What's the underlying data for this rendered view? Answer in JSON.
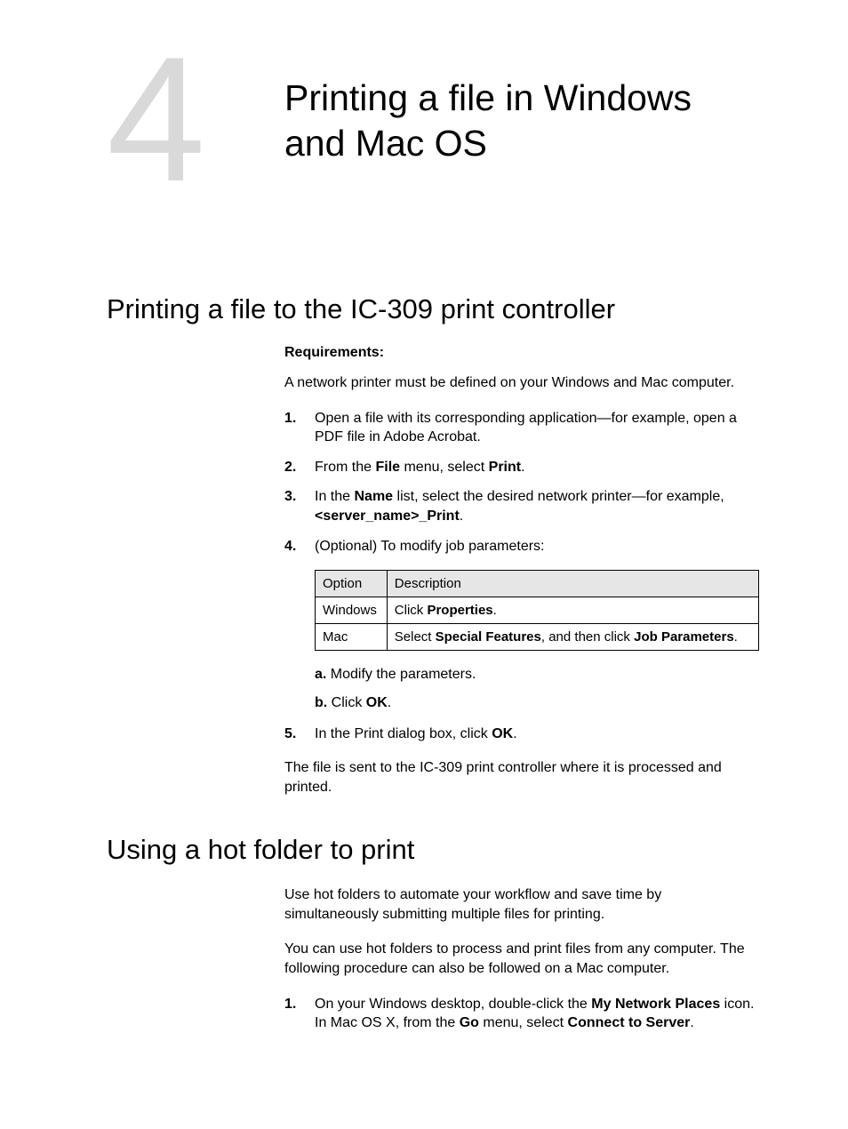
{
  "chapter": {
    "number": "4",
    "title": "Printing a file in Windows and Mac OS"
  },
  "section1": {
    "title": "Printing a file to the IC-309 print controller",
    "requirements_label": "Requirements:",
    "requirements_text": "A network printer must be defined on your Windows and Mac computer.",
    "step1_a": "Open a file with its corresponding application—for example, open a PDF file in Adobe Acrobat.",
    "step2_a": "From the ",
    "step2_b": "File",
    "step2_c": " menu, select ",
    "step2_d": "Print",
    "step2_e": ".",
    "step3_a": "In the ",
    "step3_b": "Name",
    "step3_c": " list, select the desired network printer—for example, ",
    "step3_d": "<server_name>_Print",
    "step3_e": ".",
    "step4": "(Optional) To modify job parameters:",
    "table": {
      "h1": "Option",
      "h2": "Description",
      "r1c1": "Windows",
      "r1c2_a": "Click ",
      "r1c2_b": "Properties",
      "r1c2_c": ".",
      "r2c1": "Mac",
      "r2c2_a": "Select ",
      "r2c2_b": "Special Features",
      "r2c2_c": ", and then click ",
      "r2c2_d": "Job Parameters",
      "r2c2_e": "."
    },
    "sub_a_label": "a.",
    "sub_a_text": " Modify the parameters.",
    "sub_b_label": "b.",
    "sub_b_text_a": " Click ",
    "sub_b_text_b": "OK",
    "sub_b_text_c": ".",
    "step5_a": "In the Print dialog box, click ",
    "step5_b": "OK",
    "step5_c": ".",
    "closing": "The file is sent to the IC-309 print controller where it is processed and printed."
  },
  "section2": {
    "title": "Using a hot folder to print",
    "para1": "Use hot folders to automate your workflow and save time by simultaneously submitting multiple files for printing.",
    "para2": "You can use hot folders to process and print files from any computer. The following procedure can also be followed on a Mac computer.",
    "step1_a": "On your Windows desktop, double-click the ",
    "step1_b": "My Network Places",
    "step1_c": " icon.",
    "step1_line2_a": "In Mac OS X, from the ",
    "step1_line2_b": "Go",
    "step1_line2_c": " menu, select ",
    "step1_line2_d": "Connect to Server",
    "step1_line2_e": "."
  }
}
